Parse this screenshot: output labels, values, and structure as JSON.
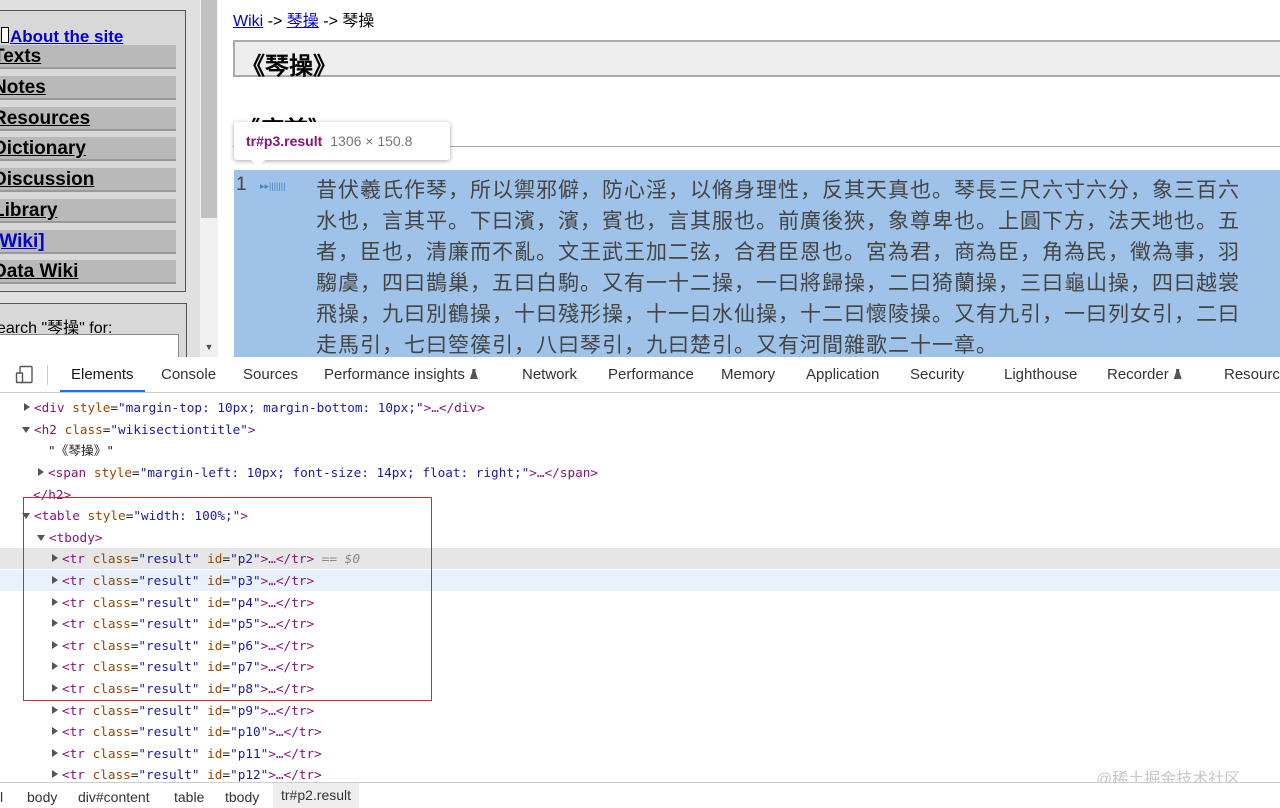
{
  "sidebar": {
    "about_link": "About the site",
    "nav_items": [
      "Texts",
      "Notes",
      "Resources",
      "Dictionary",
      "Discussion",
      "Library",
      "[Wiki]",
      "Data Wiki"
    ],
    "search_label": "earch \"琴操\" for:",
    "search_value": ""
  },
  "page": {
    "breadcrumb": {
      "wiki_link": "Wiki",
      "sep1": " -> ",
      "link2": "琴操",
      "sep2": " -> ",
      "current": "琴操"
    },
    "title": "《琴操》",
    "section_title": "《序首》",
    "row_number": "1",
    "row_icons": "▸▸|||||||",
    "lines": [
      "昔伏羲氏作琴，所以禦邪僻，防心淫，以脩身理性，反其天真也。琴長三尺六寸六分，象三百六",
      "水也，言其平。下曰濱，濱，賓也，言其服也。前廣後狹，象尊卑也。上圓下方，法天地也。五",
      "者，臣也，清廉而不亂。文王武王加二弦，合君臣恩也。宮為君，商為臣，角為民，徵為事，羽",
      "騶虞，四曰鵲巢，五曰白駒。又有一十二操，一曰將歸操，二曰猗蘭操，三曰龜山操，四曰越裳",
      "飛操，九曰別鶴操，十曰殘形操，十一曰水仙操，十二曰懷陵操。又有九引，一曰列女引，二曰",
      "走馬引，七曰箜篌引，八曰琴引，九曰楚引。又有河間雜歌二十一章。"
    ]
  },
  "tooltip": {
    "selector": "tr#p3.result",
    "dimensions": "1306 × 150.8"
  },
  "devtools": {
    "tabs": [
      "Elements",
      "Console",
      "Sources",
      "Performance insights",
      "Network",
      "Performance",
      "Memory",
      "Application",
      "Security",
      "Lighthouse",
      "Recorder",
      "Resources"
    ],
    "active_tab": "Elements",
    "dom": {
      "div_tag_open": "<div ",
      "div_attr": "style",
      "div_value": "\"margin-top: 10px; margin-bottom: 10px;\"",
      "div_close": ">…</div>",
      "h2_open": "<h2 ",
      "h2_attr": "class",
      "h2_value": "\"wikisectiontitle\"",
      "h2_gt": ">",
      "h2_text": "\"《琴操》\"",
      "span_open": "<span ",
      "span_attr": "style",
      "span_value": "\"margin-left: 10px; font-size: 14px; float: right;\"",
      "span_close": ">…</span>",
      "h2_close": "</h2>",
      "table_open": "<table ",
      "table_attr": "style",
      "table_value": "\"width: 100%;\"",
      "table_gt": ">",
      "tbody_open": "<tbody>",
      "tr_open": "<tr ",
      "tr_class_attr": "class",
      "tr_class_value": "\"result\"",
      "tr_id_attr": "id",
      "tr_close": ">…</tr>",
      "selected_marker": " == $0",
      "tr_ids": [
        "\"p2\"",
        "\"p3\"",
        "\"p4\"",
        "\"p5\"",
        "\"p6\"",
        "\"p7\"",
        "\"p8\"",
        "\"p9\"",
        "\"p10\"",
        "\"p11\"",
        "\"p12\""
      ]
    },
    "breadcrumbs": [
      "l",
      "body",
      "div#content",
      "table",
      "tbody",
      "tr#p2.result"
    ]
  },
  "watermark": "@稀土掘金技术社区",
  "colors": {
    "highlight": "#9fc3e8",
    "active_tab_underline": "#1a73e8",
    "annotation_box": "#d9242b",
    "tag": "#881280",
    "attr_name": "#994500",
    "attr_value": "#1a1aa6"
  }
}
